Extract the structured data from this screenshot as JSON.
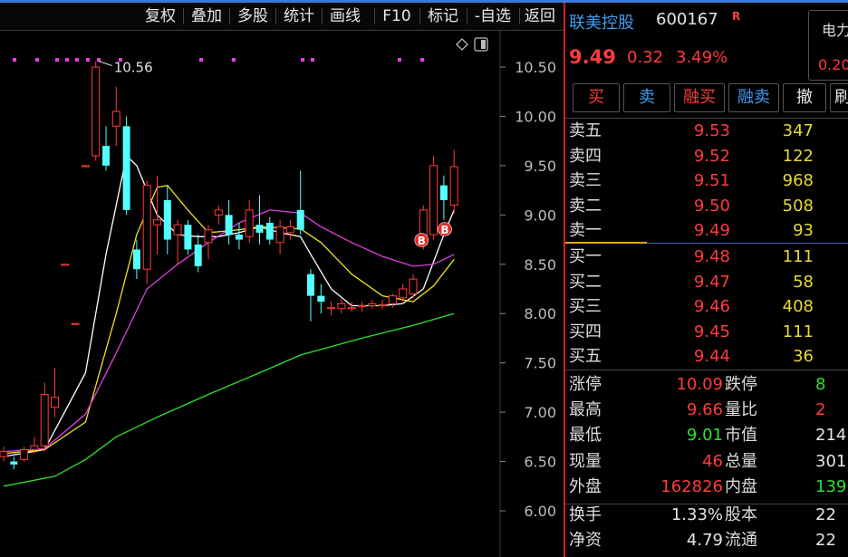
{
  "colors": {
    "up": "#ff3b3b",
    "down": "#54ffff",
    "ma5": "#ffffff",
    "ma10": "#f0e020",
    "ma20": "#e040e0",
    "ma60": "#30e030",
    "buy_marker": "#e82525"
  },
  "toolbar": {
    "items": [
      "复权",
      "叠加",
      "多股",
      "统计",
      "画线",
      "F10",
      "标记",
      "-自选",
      "返回"
    ]
  },
  "chart_data": {
    "type": "candlestick",
    "y_ticks": [
      "10.50",
      "10.00",
      "9.50",
      "9.00",
      "8.50",
      "8.00",
      "7.50",
      "7.00",
      "6.50",
      "6.00"
    ],
    "ylim": [
      5.85,
      10.75
    ],
    "high_label": "10.56",
    "candles": [
      {
        "o": 6.55,
        "h": 6.65,
        "l": 6.5,
        "c": 6.6
      },
      {
        "o": 6.5,
        "h": 6.55,
        "l": 6.42,
        "c": 6.47
      },
      {
        "o": 6.52,
        "h": 6.65,
        "l": 6.5,
        "c": 6.62
      },
      {
        "o": 6.62,
        "h": 6.75,
        "l": 6.58,
        "c": 6.66
      },
      {
        "o": 6.66,
        "h": 7.3,
        "l": 6.6,
        "c": 7.18
      },
      {
        "o": 7.05,
        "h": 7.45,
        "l": 6.95,
        "c": 7.15
      },
      {
        "o": 8.5,
        "h": 8.5,
        "l": 8.5,
        "c": 8.5
      },
      {
        "o": 7.9,
        "h": 7.9,
        "l": 7.9,
        "c": 7.9
      },
      {
        "o": 9.5,
        "h": 9.5,
        "l": 9.5,
        "c": 9.5
      },
      {
        "o": 9.6,
        "h": 10.56,
        "l": 9.55,
        "c": 10.5
      },
      {
        "o": 9.7,
        "h": 9.9,
        "l": 9.45,
        "c": 9.5
      },
      {
        "o": 9.9,
        "h": 10.3,
        "l": 9.7,
        "c": 10.05
      },
      {
        "o": 9.9,
        "h": 10.0,
        "l": 9.0,
        "c": 9.05
      },
      {
        "o": 8.65,
        "h": 8.75,
        "l": 8.35,
        "c": 8.45
      },
      {
        "o": 8.45,
        "h": 9.35,
        "l": 8.3,
        "c": 9.3
      },
      {
        "o": 8.9,
        "h": 9.4,
        "l": 8.6,
        "c": 8.95
      },
      {
        "o": 9.15,
        "h": 9.3,
        "l": 8.6,
        "c": 8.75
      },
      {
        "o": 8.8,
        "h": 8.95,
        "l": 8.5,
        "c": 8.9
      },
      {
        "o": 8.9,
        "h": 8.95,
        "l": 8.6,
        "c": 8.65
      },
      {
        "o": 8.7,
        "h": 8.8,
        "l": 8.42,
        "c": 8.48
      },
      {
        "o": 8.72,
        "h": 8.9,
        "l": 8.55,
        "c": 8.85
      },
      {
        "o": 9.0,
        "h": 9.1,
        "l": 8.9,
        "c": 9.05
      },
      {
        "o": 9.0,
        "h": 9.15,
        "l": 8.7,
        "c": 8.8
      },
      {
        "o": 8.8,
        "h": 8.92,
        "l": 8.65,
        "c": 8.75
      },
      {
        "o": 8.78,
        "h": 9.15,
        "l": 8.72,
        "c": 9.05
      },
      {
        "o": 8.9,
        "h": 9.2,
        "l": 8.7,
        "c": 8.82
      },
      {
        "o": 8.92,
        "h": 8.98,
        "l": 8.7,
        "c": 8.75
      },
      {
        "o": 8.72,
        "h": 8.95,
        "l": 8.6,
        "c": 8.88
      },
      {
        "o": 8.82,
        "h": 8.95,
        "l": 8.75,
        "c": 8.88
      },
      {
        "o": 9.05,
        "h": 9.45,
        "l": 8.8,
        "c": 8.85
      },
      {
        "o": 8.4,
        "h": 8.45,
        "l": 7.92,
        "c": 8.18
      },
      {
        "o": 8.18,
        "h": 8.3,
        "l": 8.0,
        "c": 8.12
      },
      {
        "o": 8.05,
        "h": 8.12,
        "l": 7.98,
        "c": 8.06
      },
      {
        "o": 8.05,
        "h": 8.15,
        "l": 8.0,
        "c": 8.1
      },
      {
        "o": 8.06,
        "h": 8.12,
        "l": 8.02,
        "c": 8.06
      },
      {
        "o": 8.07,
        "h": 8.12,
        "l": 8.02,
        "c": 8.08
      },
      {
        "o": 8.08,
        "h": 8.14,
        "l": 8.05,
        "c": 8.1
      },
      {
        "o": 8.08,
        "h": 8.14,
        "l": 8.05,
        "c": 8.09
      },
      {
        "o": 8.1,
        "h": 8.2,
        "l": 8.06,
        "c": 8.18
      },
      {
        "o": 8.16,
        "h": 8.3,
        "l": 8.1,
        "c": 8.25
      },
      {
        "o": 8.2,
        "h": 8.4,
        "l": 8.15,
        "c": 8.35
      },
      {
        "o": 8.7,
        "h": 9.1,
        "l": 8.65,
        "c": 9.05
      },
      {
        "o": 8.8,
        "h": 9.6,
        "l": 8.75,
        "c": 9.5
      },
      {
        "o": 9.3,
        "h": 9.4,
        "l": 8.95,
        "c": 9.15
      },
      {
        "o": 9.1,
        "h": 9.66,
        "l": 9.01,
        "c": 9.49
      }
    ],
    "lines": [
      {
        "name": "MA5",
        "values": [
          [
            0,
            6.55
          ],
          [
            4,
            6.62
          ],
          [
            8,
            7.4
          ],
          [
            10,
            8.6
          ],
          [
            12,
            9.6
          ],
          [
            13,
            9.5
          ],
          [
            15,
            9.0
          ],
          [
            17,
            8.8
          ],
          [
            19,
            8.78
          ],
          [
            21,
            8.78
          ],
          [
            23,
            8.82
          ],
          [
            25,
            8.88
          ],
          [
            27,
            8.82
          ],
          [
            29,
            8.78
          ],
          [
            30,
            8.6
          ],
          [
            32,
            8.25
          ],
          [
            34,
            8.08
          ],
          [
            37,
            8.08
          ],
          [
            39,
            8.1
          ],
          [
            41,
            8.25
          ],
          [
            43,
            8.8
          ],
          [
            44,
            9.05
          ]
        ]
      },
      {
        "name": "MA10",
        "values": [
          [
            0,
            6.58
          ],
          [
            4,
            6.62
          ],
          [
            8,
            6.9
          ],
          [
            11,
            8.0
          ],
          [
            13,
            8.8
          ],
          [
            15,
            9.28
          ],
          [
            16,
            9.3
          ],
          [
            18,
            9.05
          ],
          [
            20,
            8.82
          ],
          [
            23,
            8.85
          ],
          [
            25,
            8.88
          ],
          [
            27,
            8.87
          ],
          [
            29,
            8.86
          ],
          [
            31,
            8.72
          ],
          [
            34,
            8.4
          ],
          [
            37,
            8.18
          ],
          [
            40,
            8.12
          ],
          [
            42,
            8.28
          ],
          [
            44,
            8.55
          ]
        ]
      },
      {
        "name": "MA20",
        "values": [
          [
            0,
            6.6
          ],
          [
            4,
            6.63
          ],
          [
            8,
            6.98
          ],
          [
            11,
            7.6
          ],
          [
            14,
            8.25
          ],
          [
            17,
            8.5
          ],
          [
            20,
            8.72
          ],
          [
            23,
            8.92
          ],
          [
            26,
            9.05
          ],
          [
            29,
            9.02
          ],
          [
            31,
            8.88
          ],
          [
            34,
            8.72
          ],
          [
            37,
            8.58
          ],
          [
            40,
            8.48
          ],
          [
            42,
            8.5
          ],
          [
            44,
            8.6
          ]
        ]
      },
      {
        "name": "MA60",
        "values": [
          [
            0,
            6.25
          ],
          [
            5,
            6.35
          ],
          [
            8,
            6.52
          ],
          [
            11,
            6.75
          ],
          [
            15,
            6.95
          ],
          [
            20,
            7.18
          ],
          [
            25,
            7.4
          ],
          [
            29,
            7.58
          ],
          [
            35,
            7.75
          ],
          [
            40,
            7.88
          ],
          [
            44,
            8.0
          ]
        ]
      }
    ],
    "buy_markers": [
      {
        "index": 41,
        "label": "B"
      },
      {
        "index": 43,
        "label": "B"
      }
    ],
    "signal_dots_count": 11
  },
  "quote": {
    "name": "联美控股",
    "code": "600167",
    "badge": "R",
    "price": "9.49",
    "change": "0.32",
    "pct": "3.49%",
    "side_title": "电力",
    "side_value": "0.20"
  },
  "trade_buttons": [
    {
      "label": "买",
      "color": "#ff3b3b"
    },
    {
      "label": "卖",
      "color": "#3d9cf0"
    },
    {
      "label": "融买",
      "color": "#ff3b3b"
    },
    {
      "label": "融卖",
      "color": "#3d9cf0"
    },
    {
      "label": "撤",
      "color": "#e6e6e6"
    },
    {
      "label": "刷",
      "color": "#e6e6e6"
    }
  ],
  "orderbook": {
    "asks": [
      {
        "label": "卖五",
        "price": "9.53",
        "vol": "347"
      },
      {
        "label": "卖四",
        "price": "9.52",
        "vol": "122"
      },
      {
        "label": "卖三",
        "price": "9.51",
        "vol": "968"
      },
      {
        "label": "卖二",
        "price": "9.50",
        "vol": "508"
      },
      {
        "label": "卖一",
        "price": "9.49",
        "vol": "93"
      }
    ],
    "bids": [
      {
        "label": "买一",
        "price": "9.48",
        "vol": "111"
      },
      {
        "label": "买二",
        "price": "9.47",
        "vol": "58"
      },
      {
        "label": "买三",
        "price": "9.46",
        "vol": "408"
      },
      {
        "label": "买四",
        "price": "9.45",
        "vol": "111"
      },
      {
        "label": "买五",
        "price": "9.44",
        "vol": "36"
      }
    ]
  },
  "stats": [
    {
      "k1": "涨停",
      "v1": "10.09",
      "c1": "#ff3b3b",
      "k2": "跌停",
      "v2": "8",
      "c2": "#30e030"
    },
    {
      "k1": "最高",
      "v1": "9.66",
      "c1": "#ff3b3b",
      "k2": "量比",
      "v2": "2",
      "c2": "#ff3b3b"
    },
    {
      "k1": "最低",
      "v1": "9.01",
      "c1": "#30e030",
      "k2": "市值",
      "v2": "214",
      "c2": "#e6e6e6"
    },
    {
      "k1": "现量",
      "v1": "46",
      "c1": "#ff3b3b",
      "k2": "总量",
      "v2": "301",
      "c2": "#e6e6e6"
    },
    {
      "k1": "外盘",
      "v1": "162826",
      "c1": "#ff3b3b",
      "k2": "内盘",
      "v2": "139",
      "c2": "#30e030"
    },
    {
      "k1": "换手",
      "v1": "1.33%",
      "c1": "#e6e6e6",
      "k2": "股本",
      "v2": "22",
      "c2": "#e6e6e6"
    },
    {
      "k1": "净资",
      "v1": "4.79",
      "c1": "#e6e6e6",
      "k2": "流通",
      "v2": "22",
      "c2": "#e6e6e6"
    }
  ]
}
